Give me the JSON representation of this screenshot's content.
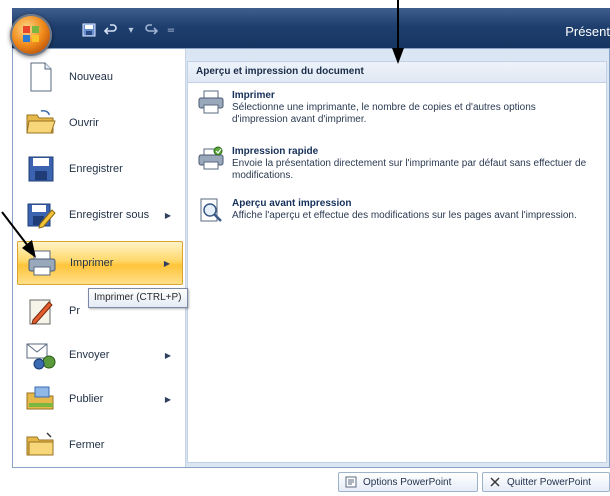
{
  "title_bar": {
    "app_title": "Présent"
  },
  "qat": {
    "icons": [
      "save-icon",
      "undo-icon",
      "redo-icon"
    ]
  },
  "menu": {
    "items": [
      {
        "label": "Nouveau",
        "icon": "new-document-icon",
        "has_submenu": false
      },
      {
        "label": "Ouvrir",
        "icon": "open-folder-icon",
        "has_submenu": false
      },
      {
        "label": "Enregistrer",
        "icon": "save-icon",
        "has_submenu": false
      },
      {
        "label": "Enregistrer sous",
        "icon": "save-as-icon",
        "has_submenu": true
      },
      {
        "label": "Imprimer",
        "icon": "printer-icon",
        "has_submenu": true,
        "active": true
      },
      {
        "label": "Pr",
        "icon": "prepare-icon",
        "has_submenu": false
      },
      {
        "label": "Envoyer",
        "icon": "send-icon",
        "has_submenu": true
      },
      {
        "label": "Publier",
        "icon": "publish-icon",
        "has_submenu": true
      },
      {
        "label": "Fermer",
        "icon": "close-folder-icon",
        "has_submenu": false
      }
    ]
  },
  "right_pane": {
    "header": "Aperçu et impression du document",
    "items": [
      {
        "title": "Imprimer",
        "desc": "Sélectionne une imprimante, le nombre de copies et d'autres options d'impression avant d'imprimer.",
        "icon": "printer-icon"
      },
      {
        "title": "Impression rapide",
        "desc": "Envoie la présentation directement sur l'imprimante par défaut sans effectuer de modifications.",
        "icon": "quick-print-icon"
      },
      {
        "title": "Aperçu avant impression",
        "desc": "Affiche l'aperçu et effectue des modifications sur les pages avant l'impression.",
        "icon": "print-preview-icon"
      }
    ]
  },
  "tooltip": {
    "text": "Imprimer (CTRL+P)"
  },
  "bottom": {
    "options_label": "Options PowerPoint",
    "quit_label": "Quitter PowerPoint"
  },
  "colors": {
    "accent": "#ffc43a",
    "titlebar": "#1f3f6f",
    "menu_bg": "#dbe6f4"
  }
}
